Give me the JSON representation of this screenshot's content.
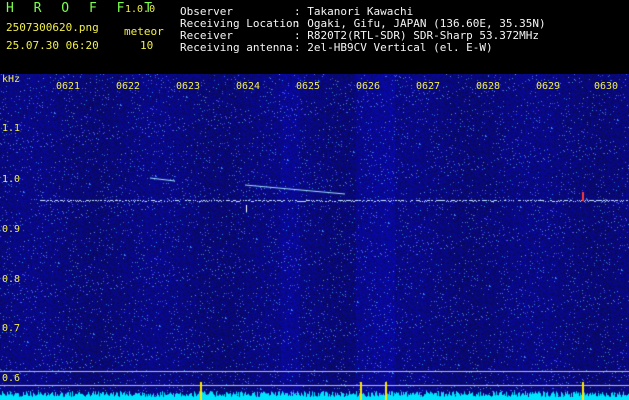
{
  "header": {
    "app_name": "H R O F F T",
    "version": "1.0.0",
    "filename": "2507300620.png",
    "datetime": "25.07.30 06:20",
    "meteor_label": "meteor",
    "meteor_count": "10",
    "info": [
      {
        "label": "Observer",
        "value": ": Takanori Kawachi"
      },
      {
        "label": "Receiving Location",
        "value": ": Ogaki, Gifu, JAPAN (136.60E, 35.35N)"
      },
      {
        "label": "Receiver",
        "value": ": R820T2(RTL-SDR) SDR-Sharp 53.372MHz"
      },
      {
        "label": "Receiving antenna",
        "value": ": 2el-HB9CV Vertical (el. E-W)"
      }
    ]
  },
  "axis": {
    "unit": "kHz",
    "y_ticks": [
      "1.1",
      "1.0",
      "0.9",
      "0.8",
      "0.7",
      "0.6"
    ],
    "x_ticks": [
      "0621",
      "0622",
      "0623",
      "0624",
      "0625",
      "0626",
      "0627",
      "0628",
      "0629",
      "0630"
    ]
  },
  "colors": {
    "background": "#000000",
    "spectrum_bg": "#0a0a6e",
    "header_green": "#7cff4f",
    "header_yellow": "#f2ef4a",
    "carrier": "#c8e6ff",
    "histogram": "#00e5ff"
  }
}
